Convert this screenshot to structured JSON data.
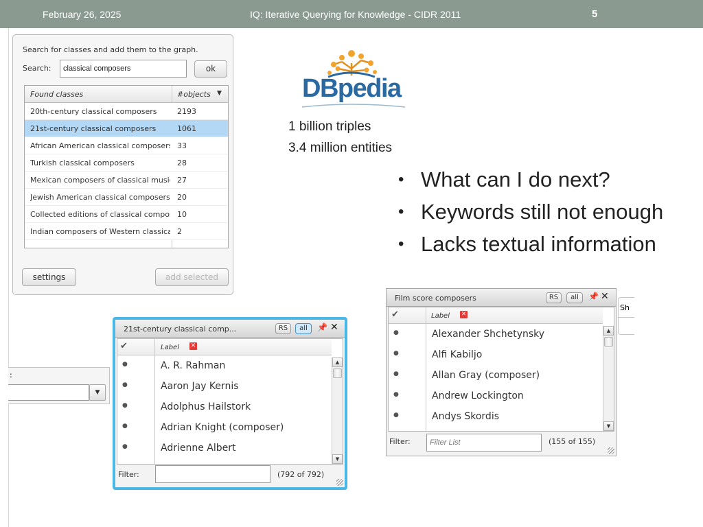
{
  "slide": {
    "date": "February 26, 2025",
    "title": "IQ: Iterative Querying for Knowledge - CIDR 2011",
    "page_number": "5"
  },
  "search_panel": {
    "instruction": "Search for classes and add them to the graph.",
    "search_label": "Search:",
    "search_value": "classical composers",
    "ok_label": "ok",
    "table": {
      "col_class": "Found classes",
      "col_objects": "#objects",
      "sort_icon": "triangle-down-icon",
      "rows": [
        {
          "name": "20th-century classical composers",
          "count": "2193"
        },
        {
          "name": "21st-century classical composers",
          "count": "1061"
        },
        {
          "name": "African American classical composers",
          "count": "33"
        },
        {
          "name": "Turkish classical composers",
          "count": "28"
        },
        {
          "name": "Mexican composers of classical music",
          "count": "27"
        },
        {
          "name": "Jewish American classical composers",
          "count": "20"
        },
        {
          "name": "Collected editions of classical composers",
          "count": "10"
        },
        {
          "name": "Indian composers of Western classical music",
          "count": "2"
        }
      ],
      "selected_index": 1
    },
    "settings_label": "settings",
    "add_selected_label": "add selected"
  },
  "logo": {
    "text": "DBpedia",
    "accent": "#f2a32c",
    "brand": "#2a69a1"
  },
  "stats": [
    "1 billion triples",
    "3.4 million entities"
  ],
  "bullets": [
    "What can I do next?",
    "Keywords still not enough",
    "Lacks textual information"
  ],
  "panel_21st": {
    "title": "21st-century classical comp...",
    "rs": "RS",
    "all": "all",
    "label_col": "Label",
    "items": [
      "A. R. Rahman",
      "Aaron Jay Kernis",
      "Adolphus Hailstork",
      "Adrian Knight (composer)",
      "Adrienne Albert"
    ],
    "filter_label": "Filter:",
    "filter_value": "",
    "count": "(792 of 792)",
    "highlight": "#49b8e6"
  },
  "panel_film": {
    "title": "Film score composers",
    "rs": "RS",
    "all": "all",
    "label_col": "Label",
    "items": [
      "Alexander Shchetynsky",
      "Alfi Kabiljo",
      "Allan Gray (composer)",
      "Andrew Lockington",
      "Andys Skordis"
    ],
    "filter_label": "Filter:",
    "filter_placeholder": "Filter List",
    "count": "(155 of 155)"
  },
  "partial_left": {
    "colon": ":"
  },
  "partial_right": {
    "text": "Sh"
  }
}
